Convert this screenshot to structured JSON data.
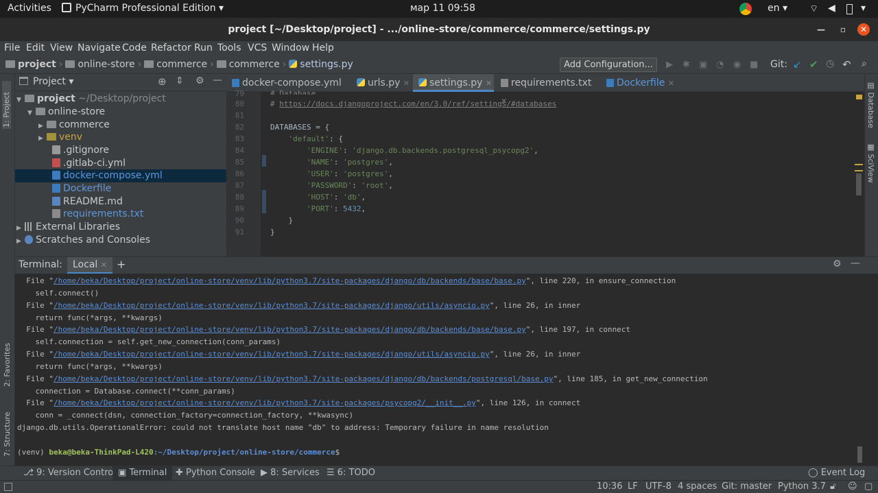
{
  "os_bar": {
    "activities": "Activities",
    "app_name": "PyCharm Professional Edition",
    "clock": "мар 11  09:58",
    "lang": "en"
  },
  "window": {
    "title": "project [~/Desktop/project] - .../online-store/commerce/commerce/settings.py"
  },
  "menu": [
    "File",
    "Edit",
    "View",
    "Navigate",
    "Code",
    "Refactor",
    "Run",
    "Tools",
    "VCS",
    "Window",
    "Help"
  ],
  "breadcrumb": [
    "project",
    "online-store",
    "commerce",
    "commerce",
    "settings.py"
  ],
  "nav": {
    "add_config": "Add Configuration...",
    "git_label": "Git:"
  },
  "left_tabs": {
    "project": "1: Project",
    "favorites": "2: Favorites",
    "structure": "7: Structure"
  },
  "right_tabs": {
    "database": "Database",
    "sciview": "SciView"
  },
  "project_panel": {
    "title": "Project",
    "root_name": "project",
    "root_path": "~/Desktop/project",
    "items": [
      "online-store",
      "commerce",
      "venv",
      ".gitignore",
      ".gitlab-ci.yml",
      "docker-compose.yml",
      "Dockerfile",
      "README.md",
      "requirements.txt",
      "External Libraries",
      "Scratches and Consoles"
    ]
  },
  "editor_tabs": [
    "docker-compose.yml",
    "urls.py",
    "settings.py",
    "requirements.txt",
    "Dockerfile"
  ],
  "code": {
    "line_numbers": [
      "79",
      "80",
      "81",
      "82",
      "83",
      "84",
      "85",
      "86",
      "87",
      "88",
      "89",
      "90",
      "91"
    ],
    "l79": "# Database",
    "l80a": "# ",
    "l80b": "https://docs.djangoproject.com/en/3.0/ref/settings/#databases",
    "l82": "DATABASES = {",
    "l83a": "    ",
    "l83b": "'default'",
    "l83c": ": {",
    "l84k": "'ENGINE'",
    "l84v": "'django.db.backends.postgresql_psycopg2'",
    "l85k": "'NAME'",
    "l85v": "'postgres'",
    "l86k": "'USER'",
    "l86v": "'postgres'",
    "l87k": "'PASSWORD'",
    "l87v": "'root'",
    "l88k": "'HOST'",
    "l88v": "'db'",
    "l89k": "'PORT'",
    "l89v": "5432",
    "l90": "    }",
    "l91": "}"
  },
  "terminal": {
    "label": "Terminal:",
    "tab": "Local",
    "lines": [
      {
        "pre": "  File \"",
        "link": "/home/beka/Desktop/project/online-store/venv/lib/python3.7/site-packages/django/db/backends/base/base.py",
        "post": "\", line 220, in ensure_connection"
      },
      {
        "pre": "    self.connect()",
        "link": "",
        "post": ""
      },
      {
        "pre": "  File \"",
        "link": "/home/beka/Desktop/project/online-store/venv/lib/python3.7/site-packages/django/utils/asyncio.py",
        "post": "\", line 26, in inner"
      },
      {
        "pre": "    return func(*args, **kwargs)",
        "link": "",
        "post": ""
      },
      {
        "pre": "  File \"",
        "link": "/home/beka/Desktop/project/online-store/venv/lib/python3.7/site-packages/django/db/backends/base/base.py",
        "post": "\", line 197, in connect"
      },
      {
        "pre": "    self.connection = self.get_new_connection(conn_params)",
        "link": "",
        "post": ""
      },
      {
        "pre": "  File \"",
        "link": "/home/beka/Desktop/project/online-store/venv/lib/python3.7/site-packages/django/utils/asyncio.py",
        "post": "\", line 26, in inner"
      },
      {
        "pre": "    return func(*args, **kwargs)",
        "link": "",
        "post": ""
      },
      {
        "pre": "  File \"",
        "link": "/home/beka/Desktop/project/online-store/venv/lib/python3.7/site-packages/django/db/backends/postgresql/base.py",
        "post": "\", line 185, in get_new_connection"
      },
      {
        "pre": "    connection = Database.connect(**conn_params)",
        "link": "",
        "post": ""
      },
      {
        "pre": "  File \"",
        "link": "/home/beka/Desktop/project/online-store/venv/lib/python3.7/site-packages/psycopg2/__init__.py",
        "post": "\", line 126, in connect"
      },
      {
        "pre": "    conn = _connect(dsn, connection_factory=connection_factory, **kwasync)",
        "link": "",
        "post": ""
      },
      {
        "pre": "django.db.utils.OperationalError: could not translate host name \"db\" to address: Temporary failure in name resolution",
        "link": "",
        "post": ""
      }
    ],
    "prompt_env": "(venv) ",
    "prompt_user": "beka@beka-ThinkPad-L420",
    "prompt_path": ":~/Desktop/project/online-store/commerce",
    "prompt_end": "$"
  },
  "tool_windows": {
    "version_control": "9: Version Control",
    "terminal": "Terminal",
    "python_console": "Python Console",
    "services": "8: Services",
    "todo": "6: TODO",
    "event_log": "Event Log"
  },
  "status": {
    "position": "10:36",
    "line_sep": "LF",
    "encoding": "UTF-8",
    "indent": "4 spaces",
    "git": "Git: master",
    "interpreter": "Python 3.7"
  }
}
